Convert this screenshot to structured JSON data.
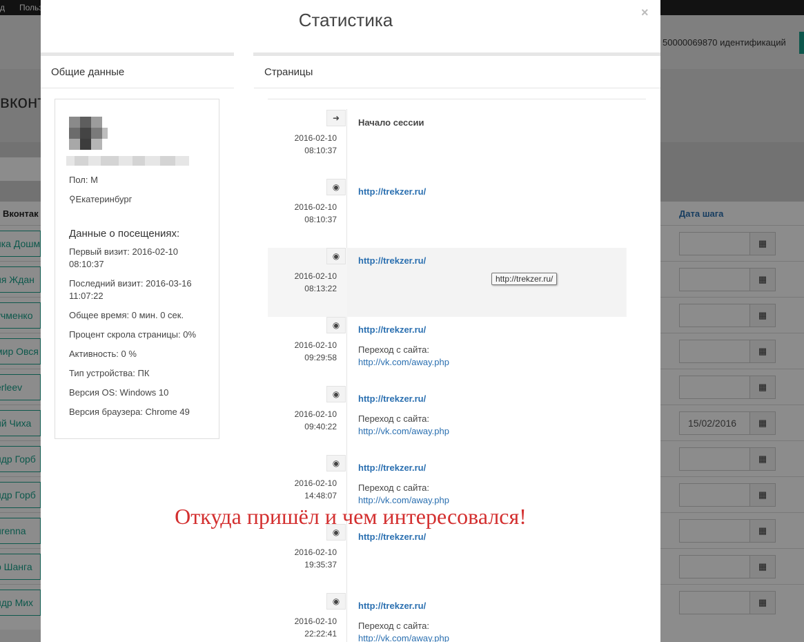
{
  "background": {
    "topbar": [
      "д",
      "Польз"
    ],
    "id_text": "50000069870 идентификаций",
    "title": "вконт",
    "col_left": "Вконтак",
    "col_right": "Дата шага",
    "names": [
      "нка Дошм",
      "ия Ждан",
      "учменко",
      "мир Овся",
      "erleev",
      "ий Чиха",
      "ндр Горб",
      "ндр Горб",
      "urenna",
      "р Шанга",
      "ндр Мих"
    ],
    "dates": [
      "",
      "",
      "",
      "",
      "",
      "15/02/2016",
      "",
      "",
      "",
      "",
      ""
    ]
  },
  "modal": {
    "title": "Статистика",
    "close": "×",
    "left_header": "Общие данные",
    "right_header": "Страницы"
  },
  "user": {
    "gender": "Пол: М",
    "city": "Екатеринбург",
    "visits_heading": "Данные о посещениях:",
    "first_visit": "Первый визит: 2016-02-10 08:10:37",
    "last_visit": "Последний визит: 2016-03-16 11:07:22",
    "total_time": "Общее время: 0 мин. 0 сек.",
    "scroll": "Процент скрола страницы: 0%",
    "activity": "Активность: 0 %",
    "device": "Тип устройства: ПК",
    "os": "Версия OS: Windows 10",
    "browser": "Версия браузера: Chrome 49"
  },
  "timeline": [
    {
      "icon": "sign-in-icon",
      "date": "2016-02-10",
      "time": "08:10:37",
      "link": "Начало сессии",
      "ref_label": "",
      "ref_url": ""
    },
    {
      "icon": "eye-icon",
      "date": "2016-02-10",
      "time": "08:10:37",
      "link": "http://trekzer.ru/",
      "ref_label": "",
      "ref_url": ""
    },
    {
      "icon": "eye-icon",
      "date": "2016-02-10",
      "time": "08:13:22",
      "link": "http://trekzer.ru/",
      "ref_label": "",
      "ref_url": ""
    },
    {
      "icon": "eye-icon",
      "date": "2016-02-10",
      "time": "09:29:58",
      "link": "http://trekzer.ru/",
      "ref_label": "Переход с сайта:",
      "ref_url": "http://vk.com/away.php"
    },
    {
      "icon": "eye-icon",
      "date": "2016-02-10",
      "time": "09:40:22",
      "link": "http://trekzer.ru/",
      "ref_label": "Переход с сайта:",
      "ref_url": "http://vk.com/away.php"
    },
    {
      "icon": "eye-icon",
      "date": "2016-02-10",
      "time": "14:48:07",
      "link": "http://trekzer.ru/",
      "ref_label": "Переход с сайта:",
      "ref_url": "http://vk.com/away.php"
    },
    {
      "icon": "eye-icon",
      "date": "2016-02-10",
      "time": "19:35:37",
      "link": "http://trekzer.ru/",
      "ref_label": "",
      "ref_url": ""
    },
    {
      "icon": "eye-icon",
      "date": "2016-02-10",
      "time": "22:22:41",
      "link": "http://trekzer.ru/",
      "ref_label": "Переход с сайта:",
      "ref_url": "http://vk.com/away.php"
    }
  ],
  "tooltip": "http://trekzer.ru/",
  "caption": "Откуда пришёл и чем интересовался!"
}
